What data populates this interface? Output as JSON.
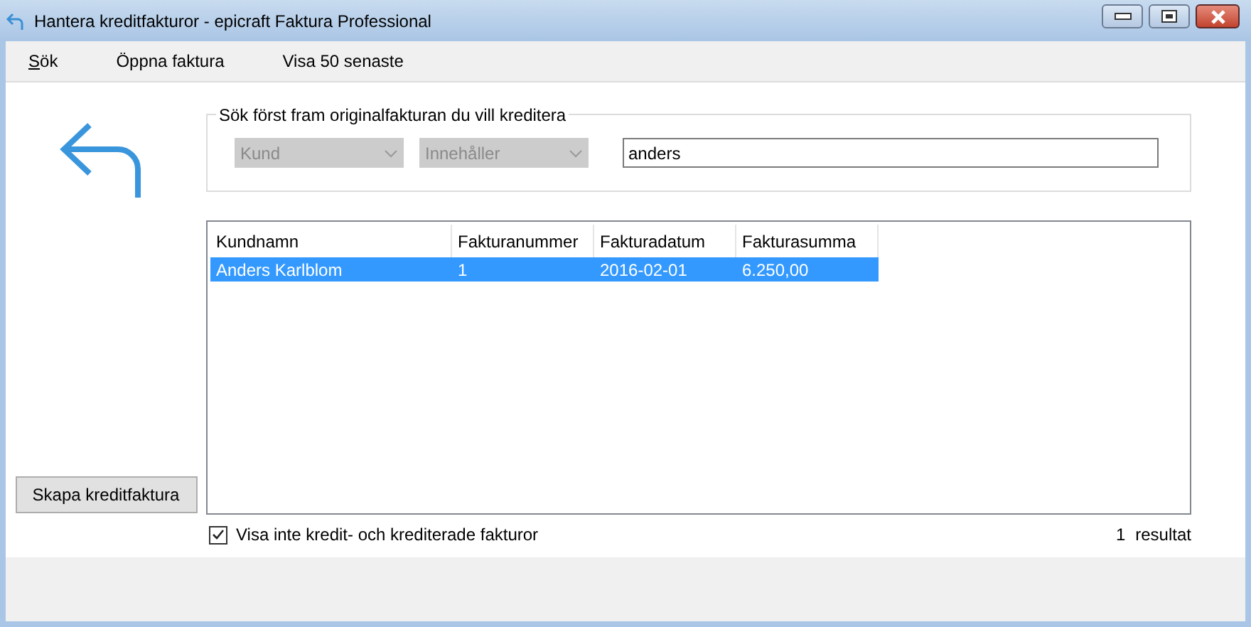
{
  "window": {
    "title": "Hantera kreditfakturor - epicraft Faktura Professional"
  },
  "menu": [
    {
      "label": "Sök"
    },
    {
      "label": "Öppna faktura"
    },
    {
      "label": "Visa 50 senaste"
    }
  ],
  "search_group": {
    "title": "Sök först fram originalfakturan du vill kreditera",
    "field_dropdown": {
      "value": "Kund",
      "disabled": true
    },
    "operator_dropdown": {
      "value": "Innehåller",
      "disabled": true
    },
    "query": {
      "value": "anders"
    }
  },
  "table": {
    "columns": [
      "Kundnamn",
      "Fakturanummer",
      "Fakturadatum",
      "Fakturasumma"
    ],
    "rows": [
      {
        "cells": [
          "Anders Karlblom",
          "1",
          "2016-02-01",
          "6.250,00"
        ],
        "selected": true
      }
    ]
  },
  "create_button": "Skapa kreditfaktura",
  "hide_credit_checkbox": {
    "label": "Visa inte kredit- och krediterade fakturor",
    "checked": true
  },
  "result_count": {
    "count": "1",
    "label": "resultat"
  }
}
